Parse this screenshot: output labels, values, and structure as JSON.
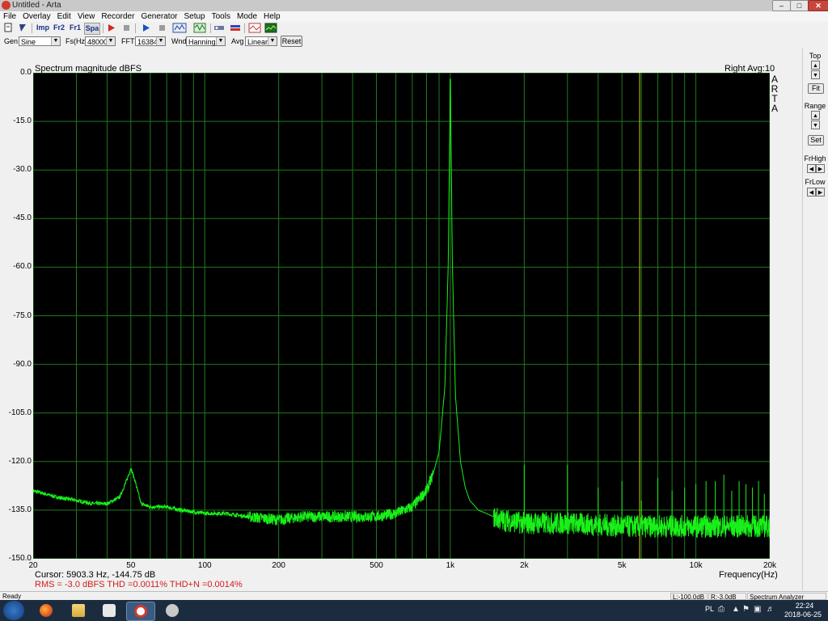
{
  "window": {
    "title": "Untitled - Arta",
    "min": "–",
    "max": "□",
    "close": "✕"
  },
  "menu": [
    "File",
    "Overlay",
    "Edit",
    "View",
    "Recorder",
    "Generator",
    "Setup",
    "Tools",
    "Mode",
    "Help"
  ],
  "toolbar": {
    "impulse": "Imp",
    "fr2": "Fr2",
    "fr1": "Fr1",
    "spa": "Spa"
  },
  "params": {
    "gen_label": "Gen",
    "gen_value": "Sine",
    "fs_label": "Fs(Hz)",
    "fs_value": "48000",
    "fft_label": "FFT",
    "fft_value": "16384",
    "wnd_label": "Wnd",
    "wnd_value": "Hanning",
    "avg_label": "Avg",
    "avg_value": "Linear",
    "reset_label": "Reset"
  },
  "plot": {
    "title": "Spectrum magnitude dBFS",
    "channel": "Right  Avg:10",
    "logo": [
      "A",
      "R",
      "T",
      "A"
    ],
    "x_label": "Frequency(Hz)",
    "cursor": "Cursor:  5903.3 Hz, -144.75 dB",
    "measure": "RMS =  -3.0 dBFS   THD =0.0011%   THD+N =0.0014%"
  },
  "right_panel": {
    "top": "Top",
    "fit": "Fit",
    "range": "Range",
    "set": "Set",
    "frhigh": "FrHigh",
    "frlow": "FrLow"
  },
  "statusbar": {
    "ready": "Ready",
    "left": "L:-100.0dB",
    "right": "R:-3.0dB",
    "mode": "Spectrum Analyzer"
  },
  "taskbar": {
    "lang": "PL",
    "time": "22:24",
    "date": "2018-06-25"
  },
  "colors": {
    "plot_bg": "#000000",
    "grid": "#1f7a1f",
    "trace": "#19f019",
    "cursor_line": "#d6d600",
    "measure_text": "#d41b1b"
  },
  "chart_data": {
    "type": "line",
    "title": "Spectrum magnitude dBFS",
    "xlabel": "Frequency(Hz)",
    "ylabel": "",
    "x_scale": "log",
    "xlim": [
      20,
      20000
    ],
    "ylim": [
      -150,
      0
    ],
    "y_ticks": [
      "0.0",
      "-15.0",
      "-30.0",
      "-45.0",
      "-60.0",
      "-75.0",
      "-90.0",
      "-105.0",
      "-120.0",
      "-135.0",
      "-150.0"
    ],
    "x_ticks": [
      {
        "v": 20,
        "label": "20"
      },
      {
        "v": 50,
        "label": "50"
      },
      {
        "v": 100,
        "label": "100"
      },
      {
        "v": 200,
        "label": "200"
      },
      {
        "v": 500,
        "label": "500"
      },
      {
        "v": 1000,
        "label": "1k"
      },
      {
        "v": 2000,
        "label": "2k"
      },
      {
        "v": 5000,
        "label": "5k"
      },
      {
        "v": 10000,
        "label": "10k"
      },
      {
        "v": 20000,
        "label": "20k"
      }
    ],
    "grid": true,
    "cursor_x": 5903.3,
    "series": [
      {
        "x": [
          20,
          25,
          30,
          35,
          40,
          45,
          48,
          50,
          52,
          55,
          60,
          70,
          80,
          100,
          120,
          150,
          200,
          250,
          300,
          400,
          500,
          600,
          700,
          800,
          850,
          900,
          950,
          980,
          1000,
          1020,
          1050,
          1100,
          1150,
          1200,
          1300,
          1400,
          1600,
          2000,
          3000,
          5000,
          8000,
          12000,
          16000,
          20000
        ],
        "y": [
          -129,
          -131,
          -132,
          -133,
          -133,
          -131,
          -126,
          -122,
          -126,
          -133,
          -134,
          -134,
          -135,
          -136,
          -136,
          -137,
          -138,
          -137,
          -137,
          -137,
          -137,
          -136,
          -134,
          -129,
          -124,
          -117,
          -97,
          -60,
          -2,
          -60,
          -100,
          -120,
          -128,
          -132,
          -135,
          -136,
          -138,
          -139,
          -139,
          -140,
          -140,
          -140,
          -140,
          -140
        ]
      }
    ],
    "harmonics": [
      {
        "x": 2000,
        "y": -121
      },
      {
        "x": 3000,
        "y": -121
      },
      {
        "x": 4000,
        "y": -128
      },
      {
        "x": 5000,
        "y": -126
      },
      {
        "x": 6000,
        "y": -132
      },
      {
        "x": 7000,
        "y": -125
      },
      {
        "x": 8000,
        "y": -129
      },
      {
        "x": 9000,
        "y": -128
      },
      {
        "x": 10000,
        "y": -127
      },
      {
        "x": 11000,
        "y": -126
      },
      {
        "x": 12000,
        "y": -126
      },
      {
        "x": 13000,
        "y": -124
      },
      {
        "x": 14000,
        "y": -129
      },
      {
        "x": 15000,
        "y": -126
      },
      {
        "x": 16000,
        "y": -127
      },
      {
        "x": 17000,
        "y": -128
      },
      {
        "x": 18000,
        "y": -126
      },
      {
        "x": 19000,
        "y": -130
      }
    ]
  }
}
